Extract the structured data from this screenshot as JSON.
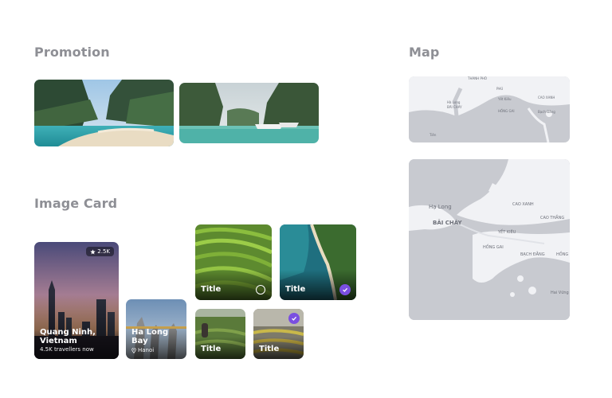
{
  "sections": {
    "promotion": "Promotion",
    "map": "Map",
    "image_card": "Image Card"
  },
  "cards": {
    "quang_ninh": {
      "badge": "2.5K",
      "title": "Quang Ninh, Vietnam",
      "subtitle": "4.5K travellers now"
    },
    "ha_long": {
      "title": "Ha Long Bay",
      "location": "Hanoi"
    },
    "rice_terrace": {
      "title": "Title"
    },
    "beach_aerial": {
      "title": "Title"
    },
    "hiker": {
      "title": "Title"
    },
    "terrace_mist": {
      "title": "Title"
    }
  },
  "map_small": {
    "labels": [
      "THÀNH PHỐ",
      "PHÚ",
      "Hà Long",
      "BÃI CHÁY",
      "Yết Kiêu",
      "CAO XANH",
      "HỒNG GAI",
      "Bạch Đằng",
      "Tiên"
    ]
  },
  "map_large": {
    "labels": [
      "Hạ Long",
      "BÃI CHÁY",
      "CAO XANH",
      "CAO THẮNG",
      "YẾT KIÊU",
      "HỒNG GAI",
      "BẠCH ĐẰNG",
      "HỒNG",
      "Hai Vững"
    ]
  },
  "icons": {
    "star": "star-icon",
    "pin": "location-pin-icon",
    "check": "check-icon"
  }
}
